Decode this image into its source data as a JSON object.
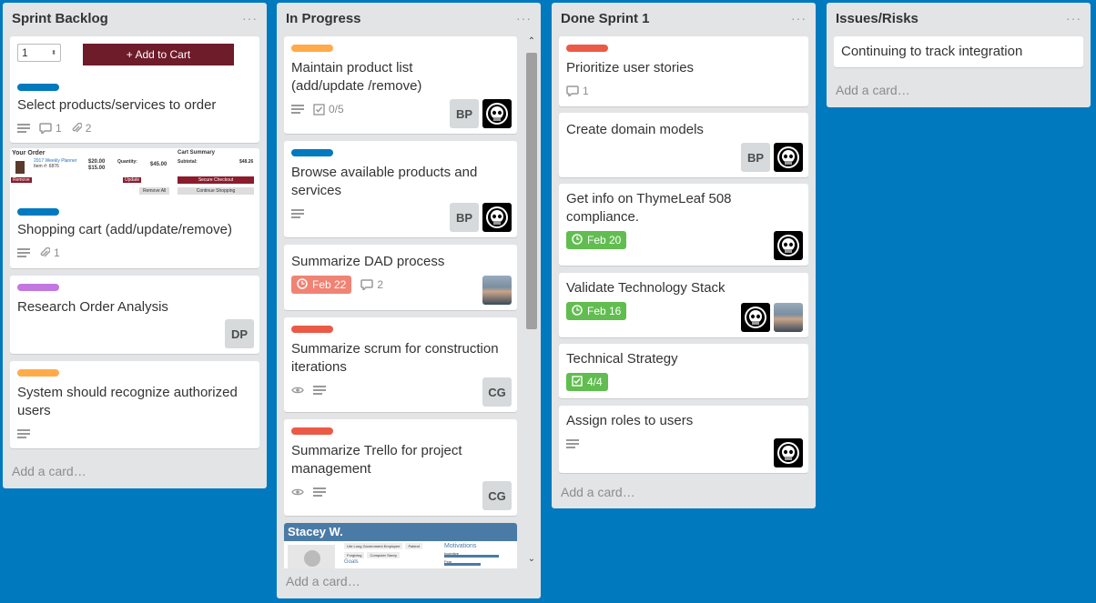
{
  "colors": {
    "board_bg": "#0079bf",
    "green": "#61bd4f",
    "orange": "#ffab4a",
    "red": "#eb5a46",
    "blue": "#0079bf",
    "purple": "#c377e0"
  },
  "add_card_label": "Add a card…",
  "menu_glyph": "···",
  "lists": [
    {
      "title": "Sprint Backlog",
      "cards": [
        {
          "cart_qty": "1",
          "cart_button": "+ Add to Cart",
          "label": "blue",
          "title": "Select products/services to order",
          "comments": "1",
          "attachments": "2"
        },
        {
          "mini_your_order": "Your Order",
          "mini_cart_summary": "Cart Summary",
          "mini_item": "2017 Weekly Planner",
          "mini_item_no": "Item #: 6876",
          "mini_price1": "$20.00",
          "mini_price2": "$15.00",
          "mini_qty": "Quantity:",
          "mini_total": "$45.00",
          "mini_subtotal": "Subtotal:",
          "mini_subtotal_val": "$48.26",
          "mini_remove": "Remove",
          "mini_update": "Update",
          "mini_remove_all": "Remove All",
          "mini_secure": "Secure Checkout",
          "mini_continue": "Continue Shopping",
          "label": "blue",
          "title": "Shopping cart (add/update/remove)",
          "attachments": "1"
        },
        {
          "label": "purple",
          "title": "Research Order Analysis",
          "members": [
            "DP"
          ]
        },
        {
          "label": "orange",
          "title": "System should recognize authorized users"
        }
      ]
    },
    {
      "title": "In Progress",
      "cards": [
        {
          "label": "orange",
          "title": "Maintain product list (add/update /remove)",
          "checklist": "0/5",
          "members": [
            "BP",
            "skull"
          ]
        },
        {
          "label": "blue",
          "title": "Browse available products and services",
          "members": [
            "BP",
            "skull"
          ]
        },
        {
          "title": "Summarize DAD process",
          "due": "Feb 22",
          "comments": "2",
          "members": [
            "photo"
          ]
        },
        {
          "label": "red",
          "title": "Summarize scrum for construction iterations",
          "members": [
            "CG"
          ]
        },
        {
          "label": "red",
          "title": "Summarize Trello for project management",
          "members": [
            "CG"
          ]
        },
        {
          "persona_name": "Stacey W.",
          "persona_tags": [
            "Life Long Government Employee",
            "Patient",
            "Forgiving",
            "Computer Savvy"
          ],
          "persona_goals": "Goals",
          "persona_motivations": "Motivations",
          "persona_m1": "Incentive",
          "persona_m2": "Fear"
        }
      ]
    },
    {
      "title": "Done Sprint 1",
      "cards": [
        {
          "label": "red",
          "title": "Prioritize user stories",
          "comments": "1"
        },
        {
          "title": "Create domain models",
          "members": [
            "BP",
            "skull"
          ]
        },
        {
          "title": "Get info on ThymeLeaf 508 compliance.",
          "due": "Feb 20",
          "members": [
            "skull"
          ]
        },
        {
          "title": "Validate Technology Stack",
          "due": "Feb 16",
          "members": [
            "skull",
            "photo"
          ]
        },
        {
          "title": "Technical Strategy",
          "checklist": "4/4"
        },
        {
          "title": "Assign roles to users",
          "members": [
            "skull"
          ]
        }
      ]
    },
    {
      "title": "Issues/Risks",
      "cards": [
        {
          "title": "Continuing to track integration"
        }
      ]
    }
  ]
}
